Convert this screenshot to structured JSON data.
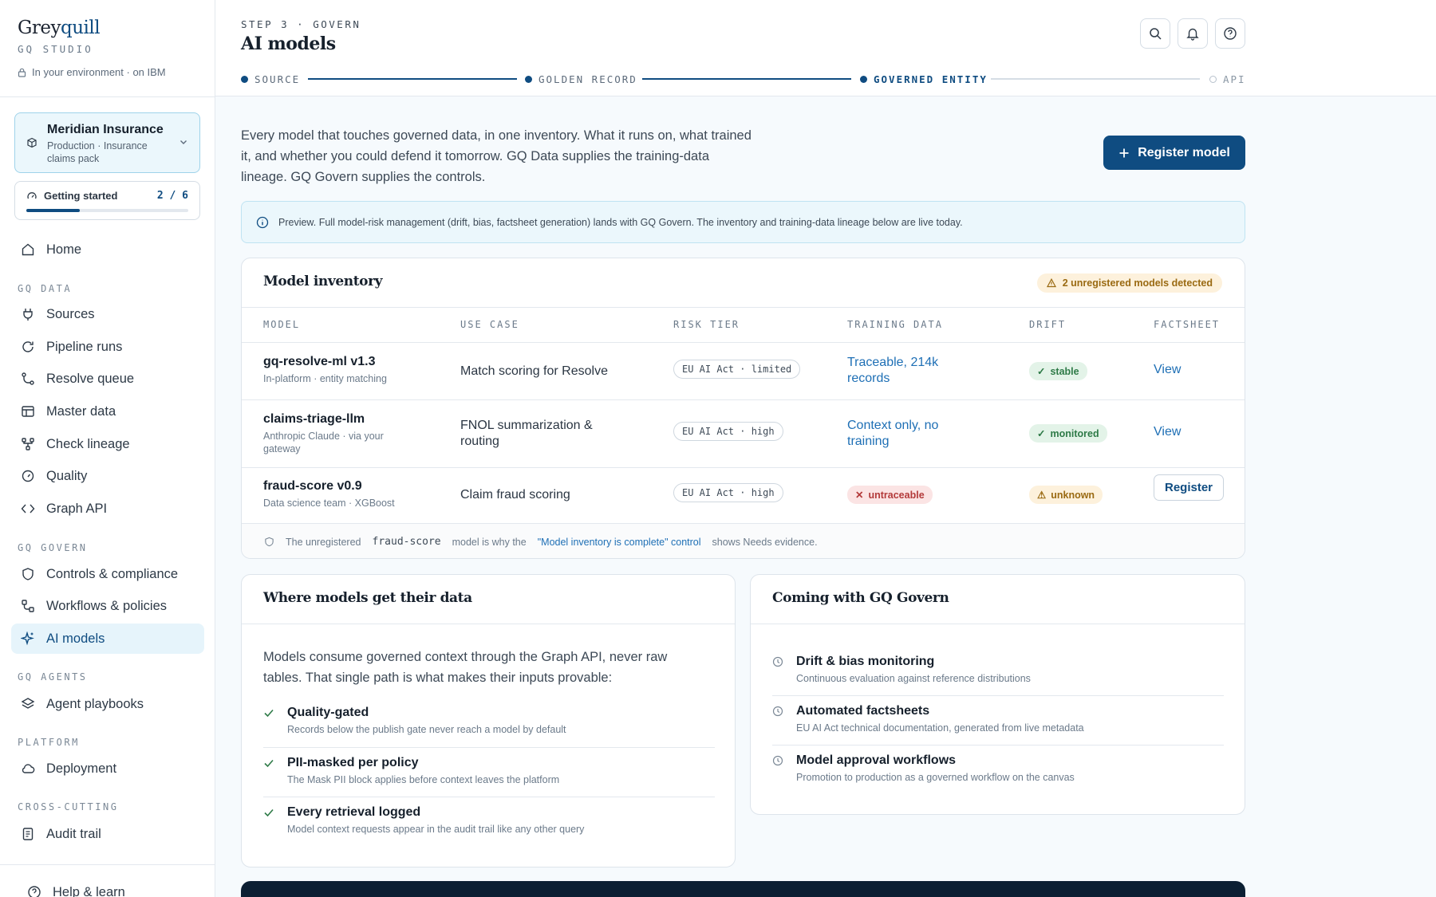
{
  "brand": {
    "name_a": "Grey",
    "name_b": "quill",
    "product": "GQ STUDIO",
    "env": "In your environment · on IBM"
  },
  "org": {
    "name": "Meridian Insurance",
    "sub": "Production · Insurance claims pack"
  },
  "getting_started": {
    "label": "Getting started",
    "count": "2 / 6",
    "progress": 0.33
  },
  "nav": {
    "home": "Home",
    "gq_data_head": "GQ DATA",
    "sources": "Sources",
    "pipeline_runs": "Pipeline runs",
    "resolve_queue": "Resolve queue",
    "master_data": "Master data",
    "check_lineage": "Check lineage",
    "quality": "Quality",
    "graph_api": "Graph API",
    "gq_govern_head": "GQ GOVERN",
    "controls": "Controls & compliance",
    "workflows": "Workflows & policies",
    "ai_models": "AI models",
    "gq_agents_head": "GQ AGENTS",
    "agent_playbooks": "Agent playbooks",
    "platform_head": "PLATFORM",
    "deployment": "Deployment",
    "cross_cutting_head": "CROSS-CUTTING",
    "audit_trail": "Audit trail",
    "help": "Help & learn"
  },
  "header": {
    "step": "STEP 3 · GOVERN",
    "title": "AI models",
    "stepper": [
      "SOURCE",
      "GOLDEN RECORD",
      "GOVERNED ENTITY",
      "API"
    ]
  },
  "intro": "Every model that touches governed data, in one inventory. What it runs on, what trained it, and whether you could defend it tomorrow. GQ Data supplies the training-data lineage. GQ Govern supplies the controls.",
  "register_button": "Register model",
  "banner": "Preview. Full model-risk management (drift, bias, factsheet generation) lands with GQ Govern. The inventory and training-data lineage below are live today.",
  "inventory": {
    "title": "Model inventory",
    "warning": "2 unregistered models detected",
    "columns": [
      "MODEL",
      "USE CASE",
      "RISK TIER",
      "TRAINING DATA",
      "DRIFT",
      "FACTSHEET"
    ],
    "rows": [
      {
        "name": "gq-resolve-ml v1.3",
        "sub": "In-platform · entity matching",
        "use_case": "Match scoring for Resolve",
        "risk": "EU AI Act · limited",
        "training": "Traceable, 214k records",
        "drift": "stable",
        "factsheet": "View"
      },
      {
        "name": "claims-triage-llm",
        "sub": "Anthropic Claude · via your gateway",
        "use_case": "FNOL summarization & routing",
        "risk": "EU AI Act · high",
        "training": "Context only, no training",
        "drift": "monitored",
        "factsheet": "View"
      },
      {
        "name": "fraud-score v0.9",
        "sub": "Data science team · XGBoost",
        "use_case": "Claim fraud scoring",
        "risk": "EU AI Act · high",
        "training": "untraceable",
        "drift": "unknown",
        "factsheet": "Register"
      }
    ],
    "footnote": {
      "a": "The unregistered",
      "code": "fraud-score",
      "b": "model is why the",
      "control": "\"Model inventory is complete\" control",
      "c": "shows Needs evidence."
    }
  },
  "where": {
    "title": "Where models get their data",
    "text": "Models consume governed context through the Graph API, never raw tables. That single path is what makes their inputs provable:",
    "items": [
      {
        "title": "Quality-gated",
        "sub": "Records below the publish gate never reach a model by default"
      },
      {
        "title": "PII-masked per policy",
        "sub": "The Mask PII block applies before context leaves the platform"
      },
      {
        "title": "Every retrieval logged",
        "sub": "Model context requests appear in the audit trail like any other query"
      }
    ]
  },
  "coming": {
    "title": "Coming with GQ Govern",
    "items": [
      {
        "title": "Drift & bias monitoring",
        "sub": "Continuous evaluation against reference distributions"
      },
      {
        "title": "Automated factsheets",
        "sub": "EU AI Act technical documentation, generated from live metadata"
      },
      {
        "title": "Model approval workflows",
        "sub": "Promotion to production as a governed workflow on the canvas"
      }
    ]
  },
  "colors": {
    "brand": "#0f4c81",
    "accent_bg": "#ebf7fc",
    "link": "#1e6fb5"
  }
}
